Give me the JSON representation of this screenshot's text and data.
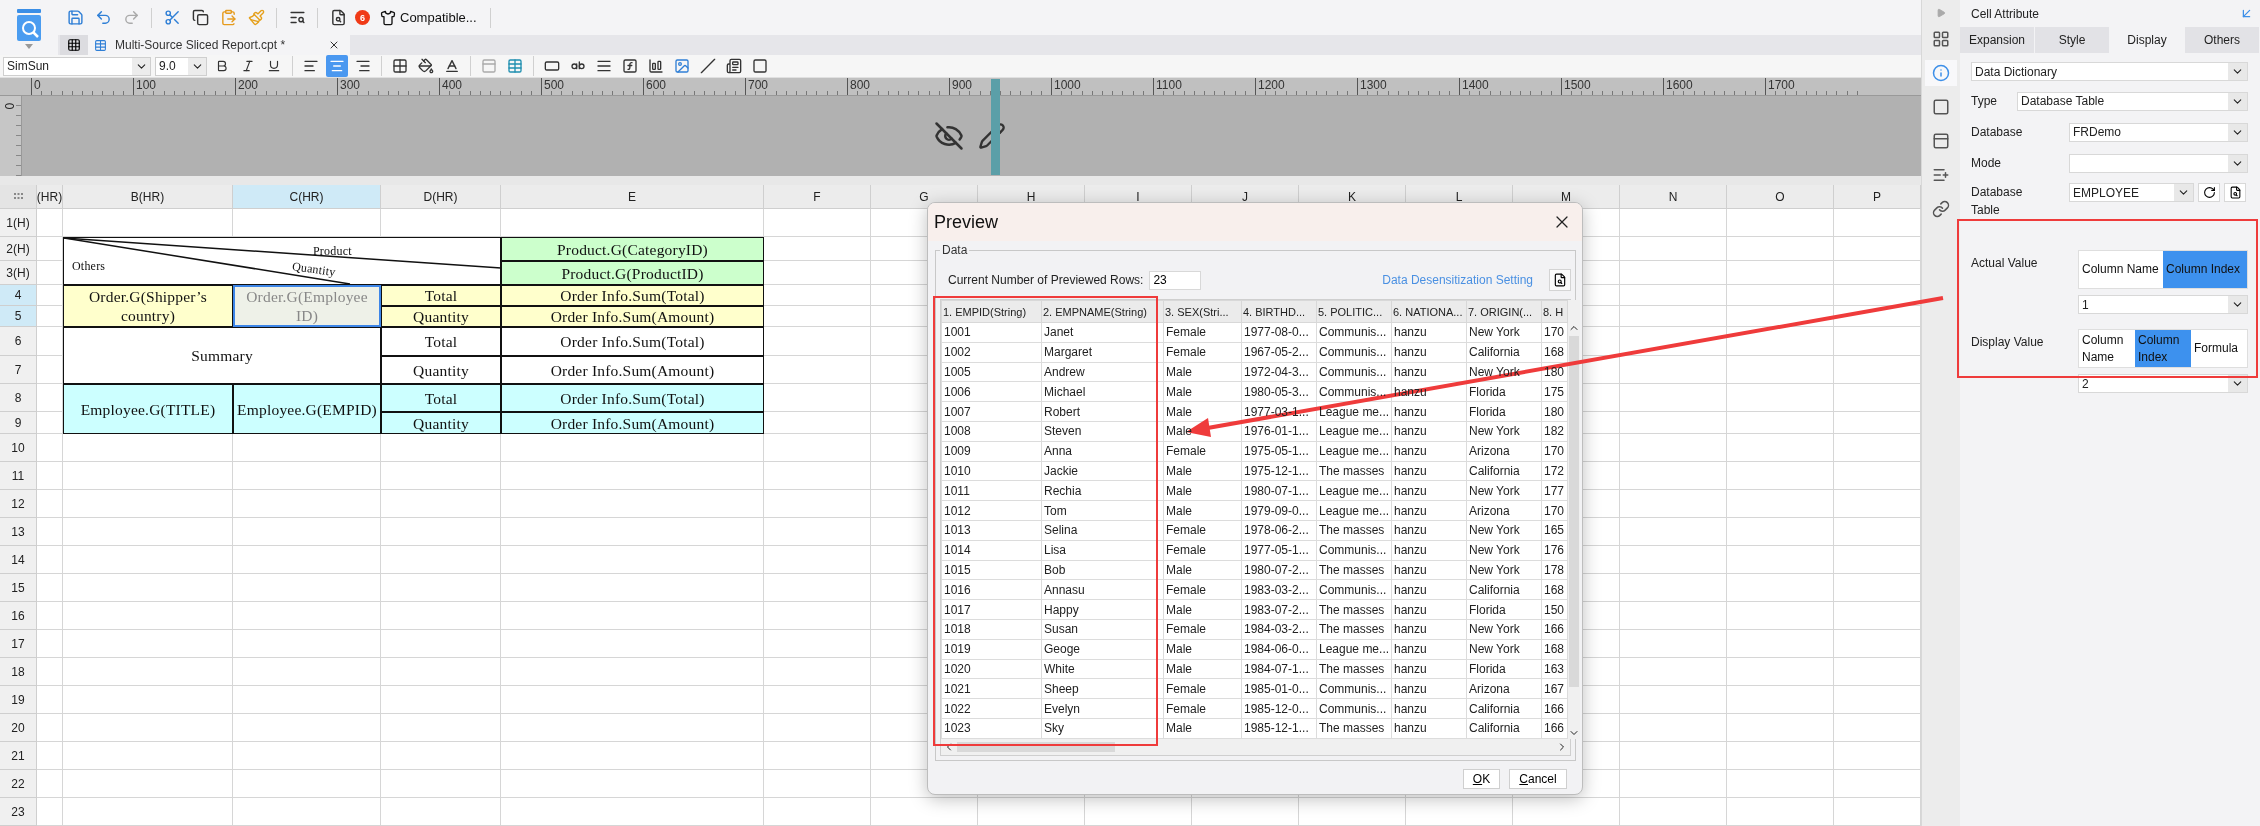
{
  "toolbar": {
    "badge": "6",
    "compatible": "Compatible..."
  },
  "document_tab": {
    "title": "Multi-Source Sliced Report.cpt *"
  },
  "format_bar": {
    "font": "SimSun",
    "size": "9.0",
    "alignment": [
      {
        "kind": "left",
        "selected": false
      },
      {
        "kind": "center",
        "selected": true
      },
      {
        "kind": "right",
        "selected": false
      }
    ]
  },
  "ruler": {
    "labels": [
      "0",
      "100",
      "200",
      "300",
      "400",
      "500",
      "600",
      "700",
      "800",
      "900",
      "1000",
      "1100",
      "1200",
      "1300",
      "1400",
      "1500",
      "1600",
      "1700"
    ],
    "vertical_label": "0"
  },
  "sheet": {
    "columns": [
      {
        "label": "(HR)",
        "selected": false
      },
      {
        "label": "B(HR)",
        "selected": false
      },
      {
        "label": "C(HR)",
        "selected": true
      },
      {
        "label": "D(HR)",
        "selected": false
      },
      {
        "label": "E",
        "selected": false
      },
      {
        "label": "F",
        "selected": false
      },
      {
        "label": "G",
        "selected": false
      },
      {
        "label": "H",
        "selected": false
      },
      {
        "label": "I",
        "selected": false
      },
      {
        "label": "J",
        "selected": false
      },
      {
        "label": "K",
        "selected": false
      },
      {
        "label": "L",
        "selected": false
      },
      {
        "label": "M",
        "selected": false
      },
      {
        "label": "N",
        "selected": false
      },
      {
        "label": "O",
        "selected": false
      },
      {
        "label": "P",
        "selected": false
      }
    ],
    "rows": [
      {
        "label": "1(H)",
        "selected": false
      },
      {
        "label": "2(H)",
        "selected": false
      },
      {
        "label": "3(H)",
        "selected": false
      },
      {
        "label": "4",
        "selected": true
      },
      {
        "label": "5",
        "selected": true
      },
      {
        "label": "6",
        "selected": false
      },
      {
        "label": "7",
        "selected": false
      },
      {
        "label": "8",
        "selected": false
      },
      {
        "label": "9",
        "selected": false
      },
      {
        "label": "10",
        "selected": false
      },
      {
        "label": "11",
        "selected": false
      },
      {
        "label": "12",
        "selected": false
      },
      {
        "label": "13",
        "selected": false
      },
      {
        "label": "14",
        "selected": false
      },
      {
        "label": "15",
        "selected": false
      },
      {
        "label": "16",
        "selected": false
      },
      {
        "label": "17",
        "selected": false
      },
      {
        "label": "18",
        "selected": false
      },
      {
        "label": "19",
        "selected": false
      },
      {
        "label": "20",
        "selected": false
      },
      {
        "label": "21",
        "selected": false
      },
      {
        "label": "22",
        "selected": false
      },
      {
        "label": "23",
        "selected": false
      }
    ],
    "cells": [
      {
        "kind": "diagonal",
        "labels": [
          "Product",
          "Quantity",
          "Others"
        ],
        "color": "#ffffff",
        "selected": false
      },
      {
        "kind": "text",
        "text": "Product.G(CategoryID)",
        "color": "#ccffcc",
        "selected": false
      },
      {
        "kind": "text",
        "text": "Product.G(ProductID)",
        "color": "#ccffcc",
        "selected": false
      },
      {
        "kind": "text",
        "text": "Order.G(Shipper’s country)",
        "color": "#ffffcc",
        "selected": false
      },
      {
        "kind": "text",
        "text": "Order.G(Employee ID)",
        "color": "#eef1e8",
        "selected": true
      },
      {
        "kind": "text",
        "text": "Total",
        "color": "#ffffcc",
        "selected": false
      },
      {
        "kind": "text",
        "text": "Order Info.Sum(Total)",
        "color": "#ffffcc",
        "selected": false
      },
      {
        "kind": "text",
        "text": "Quantity",
        "color": "#ffffcc",
        "selected": false
      },
      {
        "kind": "text",
        "text": "Order Info.Sum(Amount)",
        "color": "#ffffcc",
        "selected": false
      },
      {
        "kind": "text",
        "text": "Summary",
        "color": "#ffffff",
        "selected": false
      },
      {
        "kind": "text",
        "text": "Total",
        "color": "#ffffff",
        "selected": false
      },
      {
        "kind": "text",
        "text": "Order Info.Sum(Total)",
        "color": "#ffffff",
        "selected": false
      },
      {
        "kind": "text",
        "text": "Quantity",
        "color": "#ffffff",
        "selected": false
      },
      {
        "kind": "text",
        "text": "Order Info.Sum(Amount)",
        "color": "#ffffff",
        "selected": false
      },
      {
        "kind": "text",
        "text": "Employee.G(TITLE)",
        "color": "#ccffff",
        "selected": false
      },
      {
        "kind": "text",
        "text": "Employee.G(EMPID)",
        "color": "#ccffff",
        "selected": false
      },
      {
        "kind": "text",
        "text": "Total",
        "color": "#ccffff",
        "selected": false
      },
      {
        "kind": "text",
        "text": "Order Info.Sum(Total)",
        "color": "#ccffff",
        "selected": false
      },
      {
        "kind": "text",
        "text": "Quantity",
        "color": "#ccffff",
        "selected": false
      },
      {
        "kind": "text",
        "text": "Order Info.Sum(Amount)",
        "color": "#ccffff",
        "selected": false
      }
    ]
  },
  "preview": {
    "title": "Preview",
    "group": "Data",
    "rows_label": "Current Number of Previewed Rows:",
    "rows_value": "23",
    "link": "Data Desensitization Setting",
    "columns": [
      "1. EMPID(String)",
      "2. EMPNAME(String)",
      "3. SEX(Stri...",
      "4. BIRTHD...",
      "5. POLITIC...",
      "6. NATIONA...",
      "7. ORIGIN(...",
      "8. H"
    ],
    "rows": [
      [
        "1001",
        "Janet",
        "Female",
        "1977-08-0...",
        "Communis...",
        "hanzu",
        "New York",
        "170"
      ],
      [
        "1002",
        "Margaret",
        "Female",
        "1967-05-2...",
        "Communis...",
        "hanzu",
        "California",
        "168"
      ],
      [
        "1005",
        "Andrew",
        "Male",
        "1972-04-3...",
        "Communis...",
        "hanzu",
        "New York",
        "180"
      ],
      [
        "1006",
        "Michael",
        "Male",
        "1980-05-3...",
        "Communis...",
        "hanzu",
        "Florida",
        "175"
      ],
      [
        "1007",
        "Robert",
        "Male",
        "1977-03-1...",
        "League me...",
        "hanzu",
        "Florida",
        "180"
      ],
      [
        "1008",
        "Steven",
        "Male",
        "1976-01-1...",
        "League me...",
        "hanzu",
        "New York",
        "182"
      ],
      [
        "1009",
        "Anna",
        "Female",
        "1975-05-1...",
        "League me...",
        "hanzu",
        "Arizona",
        "170"
      ],
      [
        "1010",
        "Jackie",
        "Male",
        "1975-12-1...",
        "The masses",
        "hanzu",
        "California",
        "172"
      ],
      [
        "1011",
        "Rechia",
        "Male",
        "1980-07-1...",
        "League me...",
        "hanzu",
        "New York",
        "177"
      ],
      [
        "1012",
        "Tom",
        "Male",
        "1979-09-0...",
        "League me...",
        "hanzu",
        "Arizona",
        "170"
      ],
      [
        "1013",
        "Selina",
        "Female",
        "1978-06-2...",
        "The masses",
        "hanzu",
        "New York",
        "165"
      ],
      [
        "1014",
        "Lisa",
        "Female",
        "1977-05-1...",
        "Communis...",
        "hanzu",
        "New York",
        "176"
      ],
      [
        "1015",
        "Bob",
        "Male",
        "1980-07-2...",
        "The masses",
        "hanzu",
        "New York",
        "178"
      ],
      [
        "1016",
        "Annasu",
        "Female",
        "1983-03-2...",
        "Communis...",
        "hanzu",
        "California",
        "168"
      ],
      [
        "1017",
        "Happy",
        "Male",
        "1983-07-2...",
        "The masses",
        "hanzu",
        "Florida",
        "150"
      ],
      [
        "1018",
        "Susan",
        "Female",
        "1984-03-2...",
        "The masses",
        "hanzu",
        "New York",
        "166"
      ],
      [
        "1019",
        "Geoge",
        "Male",
        "1984-06-0...",
        "League me...",
        "hanzu",
        "New York",
        "168"
      ],
      [
        "1020",
        "White",
        "Male",
        "1984-07-1...",
        "The masses",
        "hanzu",
        "Florida",
        "163"
      ],
      [
        "1021",
        "Sheep",
        "Female",
        "1985-01-0...",
        "Communis...",
        "hanzu",
        "Arizona",
        "167"
      ],
      [
        "1022",
        "Evelyn",
        "Female",
        "1985-12-0...",
        "Communis...",
        "hanzu",
        "California",
        "166"
      ],
      [
        "1023",
        "Sky",
        "Male",
        "1985-12-1...",
        "The masses",
        "hanzu",
        "California",
        "166"
      ]
    ],
    "buttons": [
      "OK",
      "Cancel"
    ]
  },
  "side_tabs": [
    {
      "kind": "grid",
      "selected": false
    },
    {
      "kind": "info",
      "selected": true
    },
    {
      "kind": "frame",
      "selected": false
    },
    {
      "kind": "widget",
      "selected": false
    },
    {
      "kind": "list",
      "selected": false
    },
    {
      "kind": "link",
      "selected": false
    }
  ],
  "side_panel": {
    "title": "Cell Attribute",
    "tabs": [
      {
        "label": "Expansion",
        "selected": false
      },
      {
        "label": "Style",
        "selected": false
      },
      {
        "label": "Display",
        "selected": true
      },
      {
        "label": "Others",
        "selected": false
      }
    ],
    "dictionary": "Data Dictionary",
    "fields": [
      {
        "kind": "short",
        "label": "Type",
        "value": "Database Table"
      },
      {
        "kind": "select",
        "label": "Database",
        "value": "FRDemo"
      },
      {
        "kind": "select",
        "label": "Mode"
      },
      {
        "kind": "table",
        "label": "Database Table",
        "value": "EMPLOYEE"
      }
    ],
    "value_settings": [
      {
        "label": "Actual Value",
        "options": [
          {
            "label": "Column Name",
            "selected": false
          },
          {
            "label": "Column Index",
            "selected": true
          }
        ],
        "value": "1"
      },
      {
        "label": "Display Value",
        "options": [
          {
            "label": "Column Name",
            "selected": false
          },
          {
            "label": "Column Index",
            "selected": true
          },
          {
            "label": "Formula",
            "selected": false
          }
        ],
        "value": "2"
      }
    ]
  }
}
